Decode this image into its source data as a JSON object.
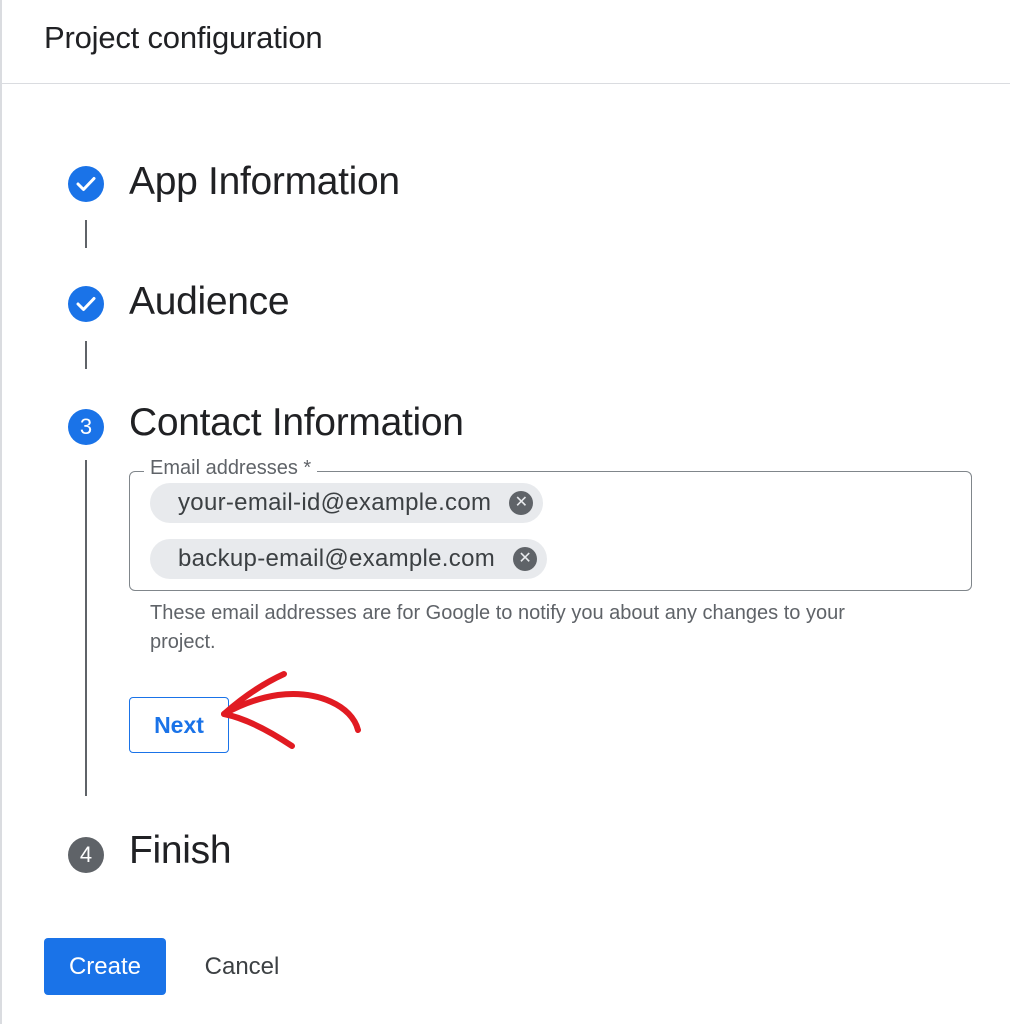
{
  "header": {
    "title": "Project configuration"
  },
  "steps": [
    {
      "label": "App Information",
      "state": "completed",
      "icon": "check-icon"
    },
    {
      "label": "Audience",
      "state": "completed",
      "icon": "check-icon"
    },
    {
      "label": "Contact Information",
      "state": "active",
      "number": "3"
    },
    {
      "label": "Finish",
      "state": "pending",
      "number": "4"
    }
  ],
  "contact_form": {
    "field_label": "Email addresses *",
    "emails": [
      "your-email-id@example.com",
      "backup-email@example.com"
    ],
    "remove_icon": "close-circle-icon",
    "helper_text": "These email addresses are for Google to notify you about any changes to your project.",
    "next_label": "Next"
  },
  "footer": {
    "create_label": "Create",
    "cancel_label": "Cancel"
  },
  "colors": {
    "primary": "#1a73e8",
    "pending": "#5f6368",
    "chip_bg": "#e8eaed",
    "annotation": "#e11b22"
  }
}
